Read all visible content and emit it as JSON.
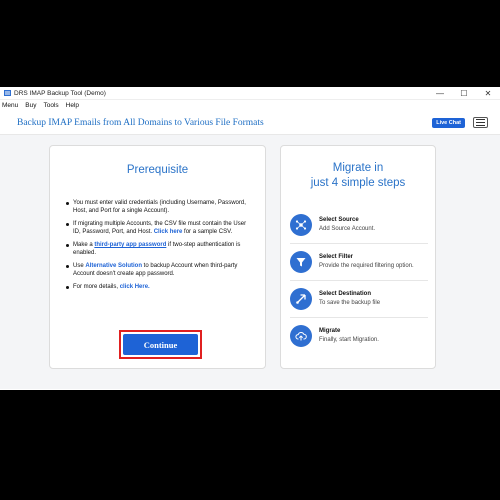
{
  "window": {
    "title": "DRS IMAP Backup Tool (Demo)",
    "controls": [
      "—",
      "☐",
      "✕"
    ]
  },
  "menubar": [
    "Menu",
    "Buy",
    "Tools",
    "Help"
  ],
  "header": {
    "heading": "Backup IMAP Emails from All Domains to Various File Formats",
    "live_chat": "Live Chat"
  },
  "prerequisite": {
    "title": "Prerequisite",
    "items": [
      {
        "pre": "You must enter valid credentials (including Username, Password, Host, and Port for a single Account)."
      },
      {
        "pre": "If migrating multiple Accounts, the CSV file must contain the User ID, Password, Port, and Host. ",
        "link": "Click here",
        "post": " for a sample CSV."
      },
      {
        "pre": "Make a ",
        "link": "third-party app password",
        "post": " if two-step authentication is enabled."
      },
      {
        "pre": "Use ",
        "link": "Alternative Solution",
        "post": " to backup Account when third-party Account doesn't create app password."
      },
      {
        "pre": "For more details, ",
        "link": "click Here.",
        "post": ""
      }
    ],
    "continue_label": "Continue"
  },
  "migrate": {
    "title_line1": "Migrate in",
    "title_line2": "just 4 simple steps",
    "steps": [
      {
        "name": "Select Source",
        "desc": "Add Source Account.",
        "icon": "source-icon"
      },
      {
        "name": "Select Filter",
        "desc": "Provide the required filtering option.",
        "icon": "filter-icon"
      },
      {
        "name": "Select Destination",
        "desc": "To save the backup file",
        "icon": "destination-icon"
      },
      {
        "name": "Migrate",
        "desc": "Finally, start Migration.",
        "icon": "upload-icon"
      }
    ]
  },
  "colors": {
    "accent": "#1e63d6",
    "title_blue": "#2a73c8",
    "highlight_border": "#e02020"
  }
}
